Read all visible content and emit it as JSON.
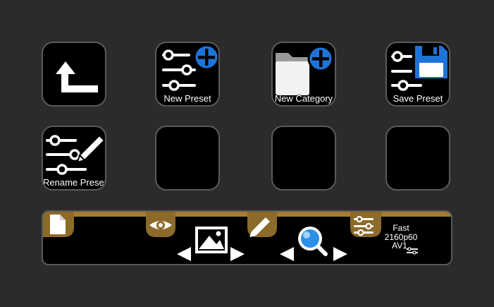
{
  "keys": {
    "back": {
      "label": ""
    },
    "new_preset": {
      "label": "New Preset"
    },
    "new_category": {
      "label": "New Category"
    },
    "save_preset": {
      "label": "Save Preset"
    },
    "rename_preset": {
      "label": "Rename Preset"
    }
  },
  "touchstrip": {
    "status": {
      "speed": "Fast",
      "resolution": "2160p60",
      "codec": "AV1"
    }
  },
  "colors": {
    "accent_gold": "#8c6a2a",
    "accent_blue": "#1e73d8",
    "key_border": "#5a5a5a",
    "background": "#2b2b2b"
  },
  "icons": [
    "back-arrow-icon",
    "sliders-icon",
    "plus-icon",
    "folder-icon",
    "floppy-disk-icon",
    "pencil-icon",
    "document-icon",
    "eye-icon",
    "image-icon",
    "magnifier-icon",
    "arrow-left-icon",
    "arrow-right-icon"
  ]
}
